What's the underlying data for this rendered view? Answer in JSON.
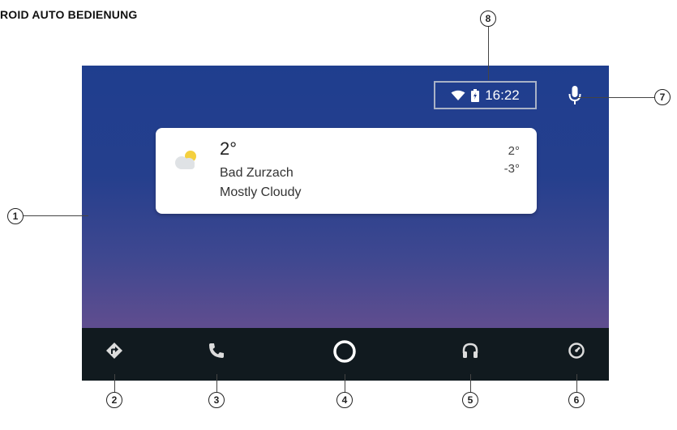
{
  "document": {
    "title": "ROID AUTO BEDIENUNG"
  },
  "status_bar": {
    "time": "16:22"
  },
  "weather_card": {
    "temperature": "2°",
    "location": "Bad Zurzach",
    "condition": "Mostly Cloudy",
    "high": "2°",
    "low": "-3°"
  },
  "callouts": {
    "screen": "1",
    "navigation": "2",
    "phone": "3",
    "home": "4",
    "audio": "5",
    "exit": "6",
    "microphone": "7",
    "status": "8"
  },
  "icons": {
    "wifi": "wifi-icon",
    "battery": "battery-charging-icon",
    "mic": "microphone-icon",
    "weather": "partly-cloudy-icon",
    "nav": "directions-icon",
    "phone": "phone-icon",
    "home": "circle-home-icon",
    "audio": "headphones-icon",
    "exit": "exit-icon"
  },
  "colors": {
    "screen_top": "#1f3e8e",
    "screen_bottom": "#6c5192",
    "nav_bar": "#111a1f",
    "card": "#ffffff"
  }
}
